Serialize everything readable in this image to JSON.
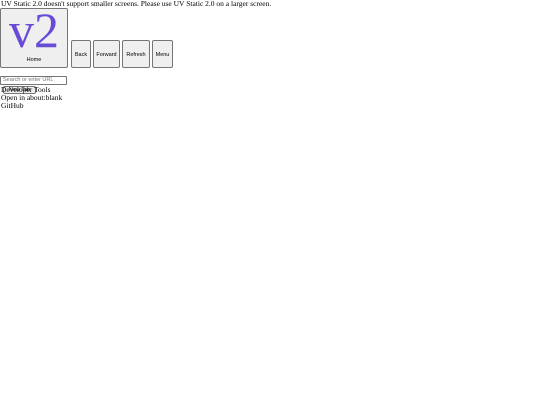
{
  "notice": {
    "text": "UV Static 2.0 doesn't support smaller screens. Please use UV Static 2.0 on a larger screen."
  },
  "toolbar": {
    "home_logo": "v2",
    "home_label": "Home",
    "back_label": "Back",
    "forward_label": "Forward",
    "refresh_label": "Refresh",
    "menu_label": "Menu"
  },
  "address_bar": {
    "value": "",
    "placeholder": "Search or enter URL"
  },
  "tabs": {
    "new_tab_label": "New Tab"
  },
  "menu_links": [
    {
      "label": "Developer Tools"
    },
    {
      "label": "Open in about:blank"
    },
    {
      "label": "GitHub"
    }
  ],
  "colors": {
    "logo": "#6a4bd8",
    "button_bg": "#efefef",
    "button_border": "#767676"
  }
}
